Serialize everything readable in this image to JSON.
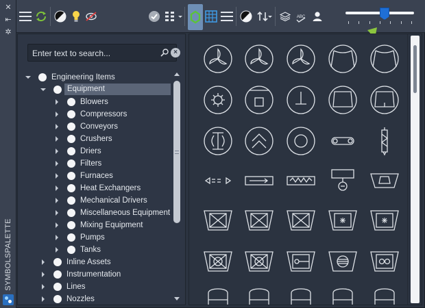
{
  "palette": {
    "title": "SYMBOLSPALETTE"
  },
  "toolbar": {
    "buttons": [
      {
        "name": "menu-icon"
      },
      {
        "name": "refresh-icon"
      },
      {
        "name": "contrast-icon"
      },
      {
        "name": "lightbulb-icon"
      },
      {
        "name": "hide-icon"
      },
      {
        "name": "checkmark-icon"
      },
      {
        "name": "grid-view-icon"
      },
      {
        "name": "tree-view-icon"
      },
      {
        "name": "table-icon"
      },
      {
        "name": "list-icon"
      },
      {
        "name": "contrast-icon"
      },
      {
        "name": "sort-icon"
      },
      {
        "name": "layers-icon"
      },
      {
        "name": "spellcheck-icon"
      },
      {
        "name": "user-icon"
      }
    ],
    "spellcheck_label": "ABC",
    "size_slider_level": 0.57,
    "active_color": "#6e8fb6"
  },
  "search": {
    "placeholder": "Enter text to search..."
  },
  "tree": {
    "items": [
      {
        "label": "Engineering Items",
        "level": 0,
        "expanded": true
      },
      {
        "label": "Equipment",
        "level": 1,
        "expanded": true,
        "selected": true
      },
      {
        "label": "Blowers",
        "level": 2
      },
      {
        "label": "Compressors",
        "level": 2
      },
      {
        "label": "Conveyors",
        "level": 2
      },
      {
        "label": "Crushers",
        "level": 2
      },
      {
        "label": "Driers",
        "level": 2
      },
      {
        "label": "Filters",
        "level": 2
      },
      {
        "label": "Furnaces",
        "level": 2
      },
      {
        "label": "Heat Exchangers",
        "level": 2
      },
      {
        "label": "Mechanical Drivers",
        "level": 2
      },
      {
        "label": "Miscellaneous Equipment",
        "level": 2
      },
      {
        "label": "Mixing Equipment",
        "level": 2
      },
      {
        "label": "Pumps",
        "level": 2
      },
      {
        "label": "Tanks",
        "level": 2
      },
      {
        "label": "Inline Assets",
        "level": 1
      },
      {
        "label": "Instrumentation",
        "level": 1
      },
      {
        "label": "Lines",
        "level": 1
      },
      {
        "label": "Nozzles",
        "level": 1
      }
    ]
  },
  "symbols": {
    "rows": [
      [
        "fan-blower-symbol",
        "fan-blower-symbol",
        "fan-blower-symbol",
        "compressor-symbol",
        "compressor-symbol"
      ],
      [
        "gear-blower-symbol",
        "compressor-box-symbol",
        "compressor-t-symbol",
        "compressor-trapezoid-symbol",
        "compressor-notch-symbol"
      ],
      [
        "crusher-symbol",
        "chevron-crusher-symbol",
        "disc-crusher-symbol",
        "belt-conveyor-symbol",
        "screw-conveyor-symbol"
      ],
      [
        "conveyor-dashed-symbol",
        "conveyor-arrow-symbol",
        "conveyor-zigzag-symbol",
        "feeder-symbol",
        "hopper-symbol"
      ],
      [
        "filter-x-symbol",
        "filter-x-symbol",
        "filter-x-symbol",
        "filter-star-symbol",
        "filter-star-symbol"
      ],
      [
        "filter-circle-x-symbol",
        "filter-circle-x-symbol",
        "filter-lollipop-symbol",
        "filter-striped-symbol",
        "filter-double-symbol"
      ],
      [
        "tank-symbol",
        "tank-symbol",
        "tank-symbol",
        "tank-symbol",
        "tank-symbol"
      ]
    ]
  },
  "colors": {
    "annotation_arrow": "#8bc53f",
    "slider_thumb": "#1f6fd6"
  }
}
